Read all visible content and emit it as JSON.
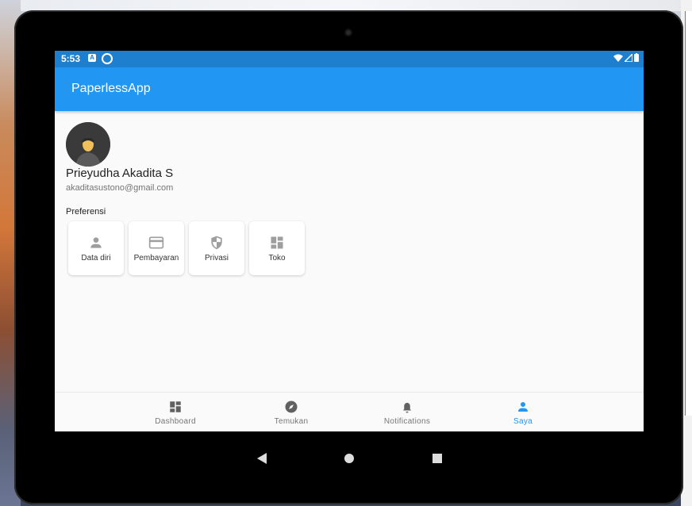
{
  "status_bar": {
    "time": "5:53",
    "icon_a": "A"
  },
  "app": {
    "title": "PaperlessApp"
  },
  "profile": {
    "name": "Prieyudha Akadita S",
    "email": "akaditasustono@gmail.com",
    "preferences_label": "Preferensi"
  },
  "tiles": [
    {
      "label": "Data diri",
      "icon": "person-icon"
    },
    {
      "label": "Pembayaran",
      "icon": "credit-card-icon"
    },
    {
      "label": "Privasi",
      "icon": "shield-icon"
    },
    {
      "label": "Toko",
      "icon": "dashboard-icon"
    }
  ],
  "bottom_nav": [
    {
      "label": "Dashboard",
      "icon": "dashboard-icon",
      "active": false
    },
    {
      "label": "Temukan",
      "icon": "compass-icon",
      "active": false
    },
    {
      "label": "Notifications",
      "icon": "bell-icon",
      "active": false
    },
    {
      "label": "Saya",
      "icon": "person-icon",
      "active": true
    }
  ],
  "colors": {
    "primary": "#2196f3",
    "status_bar": "#1f7fcf",
    "inactive": "#757575"
  }
}
